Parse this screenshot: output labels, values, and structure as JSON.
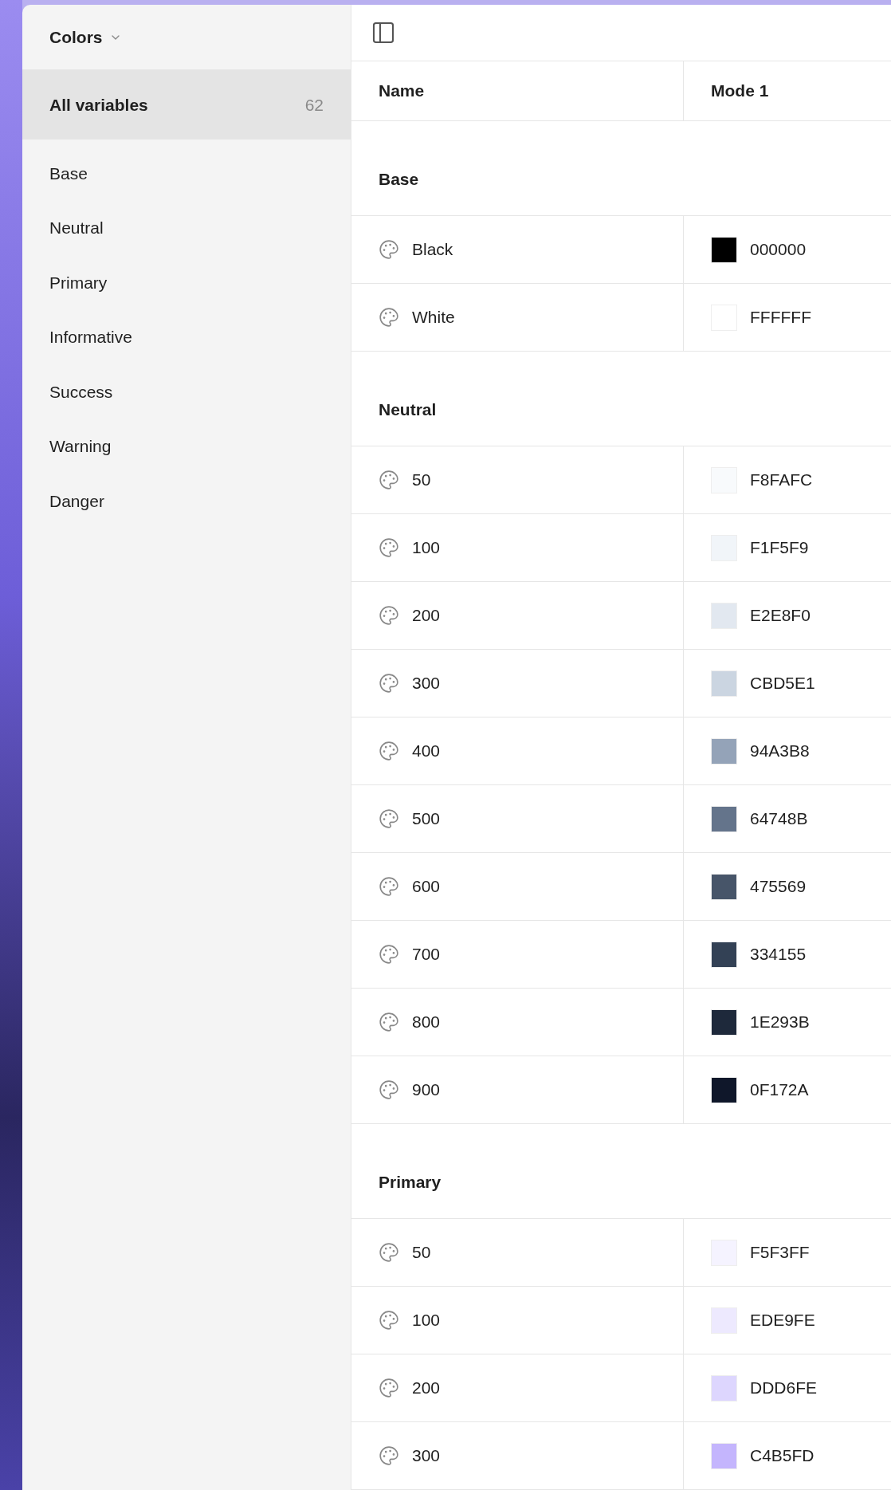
{
  "sidebar": {
    "title": "Colors",
    "items": [
      {
        "label": "All variables",
        "count": "62",
        "selected": true
      },
      {
        "label": "Base",
        "selected": false
      },
      {
        "label": "Neutral",
        "selected": false
      },
      {
        "label": "Primary",
        "selected": false
      },
      {
        "label": "Informative",
        "selected": false
      },
      {
        "label": "Success",
        "selected": false
      },
      {
        "label": "Warning",
        "selected": false
      },
      {
        "label": "Danger",
        "selected": false
      }
    ]
  },
  "table": {
    "columns": [
      "Name",
      "Mode 1"
    ],
    "groups": [
      {
        "name": "Base",
        "rows": [
          {
            "name": "Black",
            "value": "000000",
            "color": "#000000"
          },
          {
            "name": "White",
            "value": "FFFFFF",
            "color": "#ffffff"
          }
        ]
      },
      {
        "name": "Neutral",
        "rows": [
          {
            "name": "50",
            "value": "F8FAFC",
            "color": "#f8fafc"
          },
          {
            "name": "100",
            "value": "F1F5F9",
            "color": "#f1f5f9"
          },
          {
            "name": "200",
            "value": "E2E8F0",
            "color": "#e2e8f0"
          },
          {
            "name": "300",
            "value": "CBD5E1",
            "color": "#cbd5e1"
          },
          {
            "name": "400",
            "value": "94A3B8",
            "color": "#94a3b8"
          },
          {
            "name": "500",
            "value": "64748B",
            "color": "#64748b"
          },
          {
            "name": "600",
            "value": "475569",
            "color": "#475569"
          },
          {
            "name": "700",
            "value": "334155",
            "color": "#334155"
          },
          {
            "name": "800",
            "value": "1E293B",
            "color": "#1e293b"
          },
          {
            "name": "900",
            "value": "0F172A",
            "color": "#0f172a"
          }
        ]
      },
      {
        "name": "Primary",
        "rows": [
          {
            "name": "50",
            "value": "F5F3FF",
            "color": "#f5f3ff"
          },
          {
            "name": "100",
            "value": "EDE9FE",
            "color": "#ede9fe"
          },
          {
            "name": "200",
            "value": "DDD6FE",
            "color": "#ddd6fe"
          },
          {
            "name": "300",
            "value": "C4B5FD",
            "color": "#c4b5fd"
          }
        ]
      }
    ]
  }
}
